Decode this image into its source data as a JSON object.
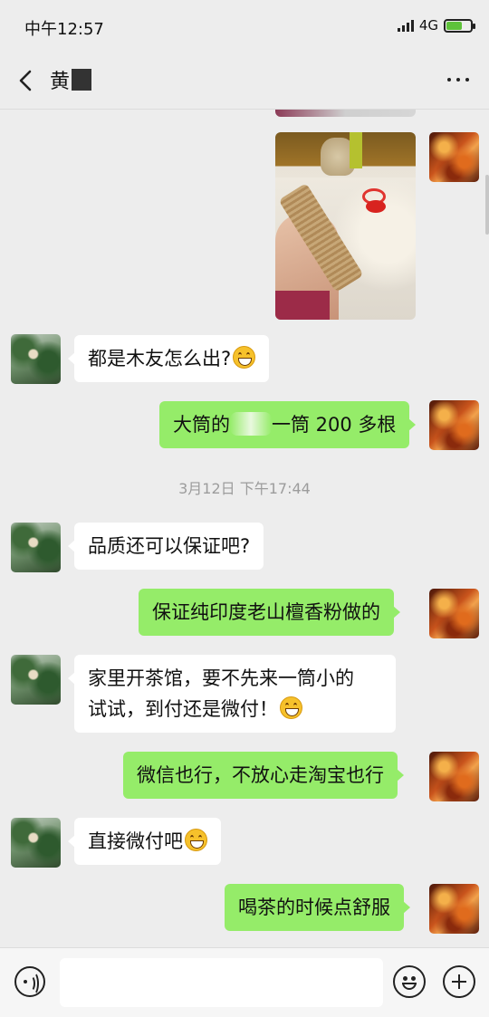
{
  "status_bar": {
    "time": "中午12:57",
    "network": "4G",
    "icons": [
      "signal-icon",
      "battery-charging-icon"
    ]
  },
  "nav": {
    "title": "黄",
    "back_icon": "chevron-left-icon",
    "more_icon": "more-icon"
  },
  "messages": [
    {
      "side": "out",
      "type": "image",
      "description": "photo"
    },
    {
      "side": "in",
      "text": "都是木友怎么出?",
      "emoji": "grin-emoji"
    },
    {
      "side": "out",
      "text_before": "大筒的",
      "text_after": "一筒 200 多根"
    },
    {
      "type": "timestamp",
      "text": "3月12日 下午17:44"
    },
    {
      "side": "in",
      "text": "品质还可以保证吧?"
    },
    {
      "side": "out",
      "text": "保证纯印度老山檀香粉做的"
    },
    {
      "side": "in",
      "line1": "家里开茶馆，要不先来一筒小的",
      "line2": "试试，到付还是微付！",
      "emoji": "grin-emoji"
    },
    {
      "side": "out",
      "text": "微信也行，不放心走淘宝也行"
    },
    {
      "side": "in",
      "text": "直接微付吧",
      "emoji": "grin-emoji"
    },
    {
      "side": "out",
      "text": "喝茶的时候点舒服"
    }
  ],
  "input_bar": {
    "voice_icon": "voice-icon",
    "emoji_icon": "emoji-icon",
    "plus_icon": "plus-icon",
    "value": ""
  },
  "colors": {
    "background": "#ededed",
    "outgoing_bubble": "#95ec69",
    "incoming_bubble": "#ffffff"
  }
}
